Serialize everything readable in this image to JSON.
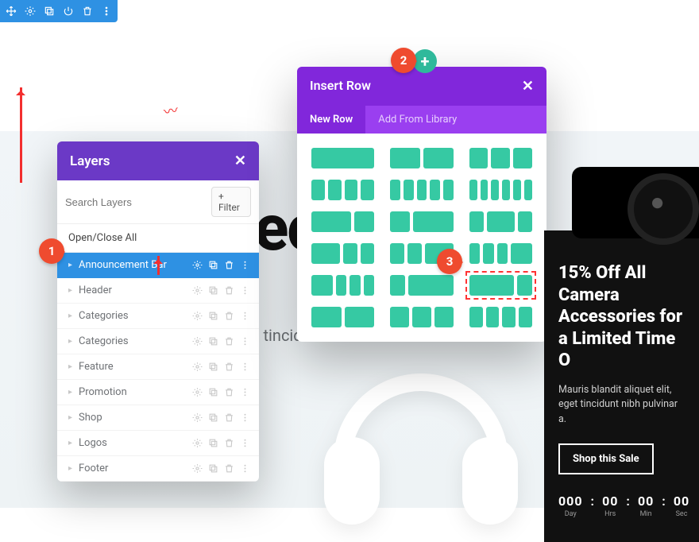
{
  "toolbar_icons": [
    "move",
    "gear",
    "duplicate",
    "power",
    "trash",
    "more"
  ],
  "bg": {
    "heading_fragment": "ec",
    "sub_fragment": "t tincid"
  },
  "layers": {
    "title": "Layers",
    "search_placeholder": "Search Layers",
    "filter_label": "+ Filter",
    "open_close": "Open/Close All",
    "items": [
      {
        "label": "Announcement Bar",
        "active": true
      },
      {
        "label": "Header",
        "active": false
      },
      {
        "label": "Categories",
        "active": false
      },
      {
        "label": "Categories",
        "active": false
      },
      {
        "label": "Feature",
        "active": false
      },
      {
        "label": "Promotion",
        "active": false
      },
      {
        "label": "Shop",
        "active": false
      },
      {
        "label": "Logos",
        "active": false
      },
      {
        "label": "Footer",
        "active": false
      }
    ]
  },
  "insert": {
    "title": "Insert Row",
    "tabs": {
      "new": "New Row",
      "lib": "Add From Library"
    },
    "layouts": [
      [
        1
      ],
      [
        1,
        1
      ],
      [
        1,
        1,
        1
      ],
      [
        1,
        1,
        1,
        1
      ],
      [
        1,
        1,
        1,
        1,
        1
      ],
      [
        1,
        1,
        1,
        1,
        1,
        1
      ],
      [
        2,
        1
      ],
      [
        1,
        2
      ],
      [
        1,
        2,
        1
      ],
      [
        2,
        1,
        1
      ],
      [
        1,
        1,
        2
      ],
      [
        1,
        1,
        1,
        2
      ],
      [
        2,
        1,
        1,
        1
      ],
      [
        1,
        3
      ],
      [
        3,
        1
      ],
      [
        1,
        1
      ],
      [
        1,
        1,
        1
      ],
      [
        1,
        1,
        1,
        1
      ]
    ],
    "selected_index": 14
  },
  "promo": {
    "heading": "15% Off All Camera Accessories for a Limited Time O",
    "body": "Mauris blandit aliquet elit, eget tincidunt nibh pulvinar a.",
    "cta": "Shop this Sale",
    "countdown": [
      {
        "num": "000",
        "lab": "Day"
      },
      {
        "num": "00",
        "lab": "Hrs"
      },
      {
        "num": "00",
        "lab": "Min"
      },
      {
        "num": "00",
        "lab": "Sec"
      }
    ]
  },
  "badges": {
    "b1": "1",
    "b2": "2",
    "b3": "3"
  },
  "add_plus": "+"
}
